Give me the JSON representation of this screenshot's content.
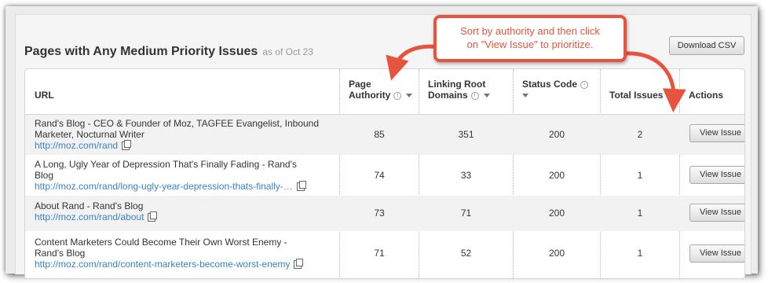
{
  "panel": {
    "title": "Pages with Any Medium Priority Issues",
    "subtitle": "as of Oct 23",
    "download_label": "Download CSV"
  },
  "table": {
    "headers": {
      "url": "URL",
      "pa_line1": "Page",
      "pa_line2": "Authority",
      "lrd_line1": "Linking Root",
      "lrd_line2": "Domains",
      "status": "Status Code",
      "total": "Total Issues",
      "actions": "Actions"
    },
    "rows": [
      {
        "title_line1": "Rand's Blog - CEO & Founder of Moz, TAGFEE Evangelist, Inbound",
        "title_line2": "Marketer, Nocturnal Writer",
        "url": "http://moz.com/rand",
        "pa": "85",
        "lrd": "351",
        "status": "200",
        "total": "2",
        "action": "View Issue"
      },
      {
        "title_line1": "A Long, Ugly Year of Depression That's Finally Fading - Rand's",
        "title_line2": "Blog",
        "url": "http://moz.com/rand/long-ugly-year-depression-thats-finally-…",
        "pa": "74",
        "lrd": "33",
        "status": "200",
        "total": "1",
        "action": "View Issue"
      },
      {
        "title_line1": "About Rand - Rand's Blog",
        "title_line2": "",
        "url": "http://moz.com/rand/about",
        "pa": "73",
        "lrd": "71",
        "status": "200",
        "total": "1",
        "action": "View Issue"
      },
      {
        "title_line1": "Content Marketers Could Become Their Own Worst Enemy -",
        "title_line2": "Rand's Blog",
        "url": "http://moz.com/rand/content-marketers-become-worst-enemy",
        "pa": "71",
        "lrd": "52",
        "status": "200",
        "total": "1",
        "action": "View Issue"
      }
    ]
  },
  "annotation": {
    "line1": "Sort by authority and then click",
    "line2": "on \"View Issue\" to prioritize.",
    "color": "#e6543f"
  },
  "icons": [
    "info-icon",
    "sort-caret-icon",
    "copy-link-icon"
  ]
}
